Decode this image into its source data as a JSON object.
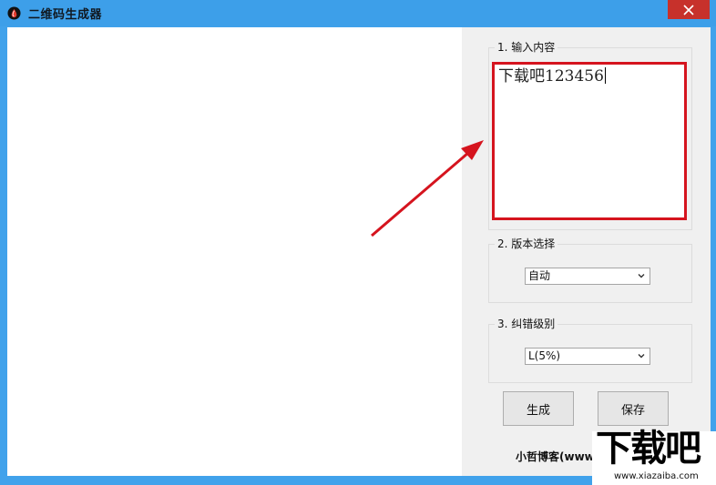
{
  "window": {
    "title": "二维码生成器",
    "close_icon": "close-icon",
    "app_icon": "droplet-icon"
  },
  "groups": {
    "content": {
      "label": "1. 输入内容",
      "value": "下载吧123456"
    },
    "version": {
      "label": "2. 版本选择",
      "selected": "自动"
    },
    "error_level": {
      "label": "3. 纠错级别",
      "selected": "L(5%)"
    }
  },
  "buttons": {
    "generate": "生成",
    "save": "保存"
  },
  "footer": {
    "text": "小哲博客(www"
  },
  "watermark": {
    "big": "下载吧",
    "url": "www.xiazaiba.com"
  },
  "colors": {
    "title_bar": "#3d9fe9",
    "close": "#c7312b",
    "highlight": "#d5141e"
  }
}
